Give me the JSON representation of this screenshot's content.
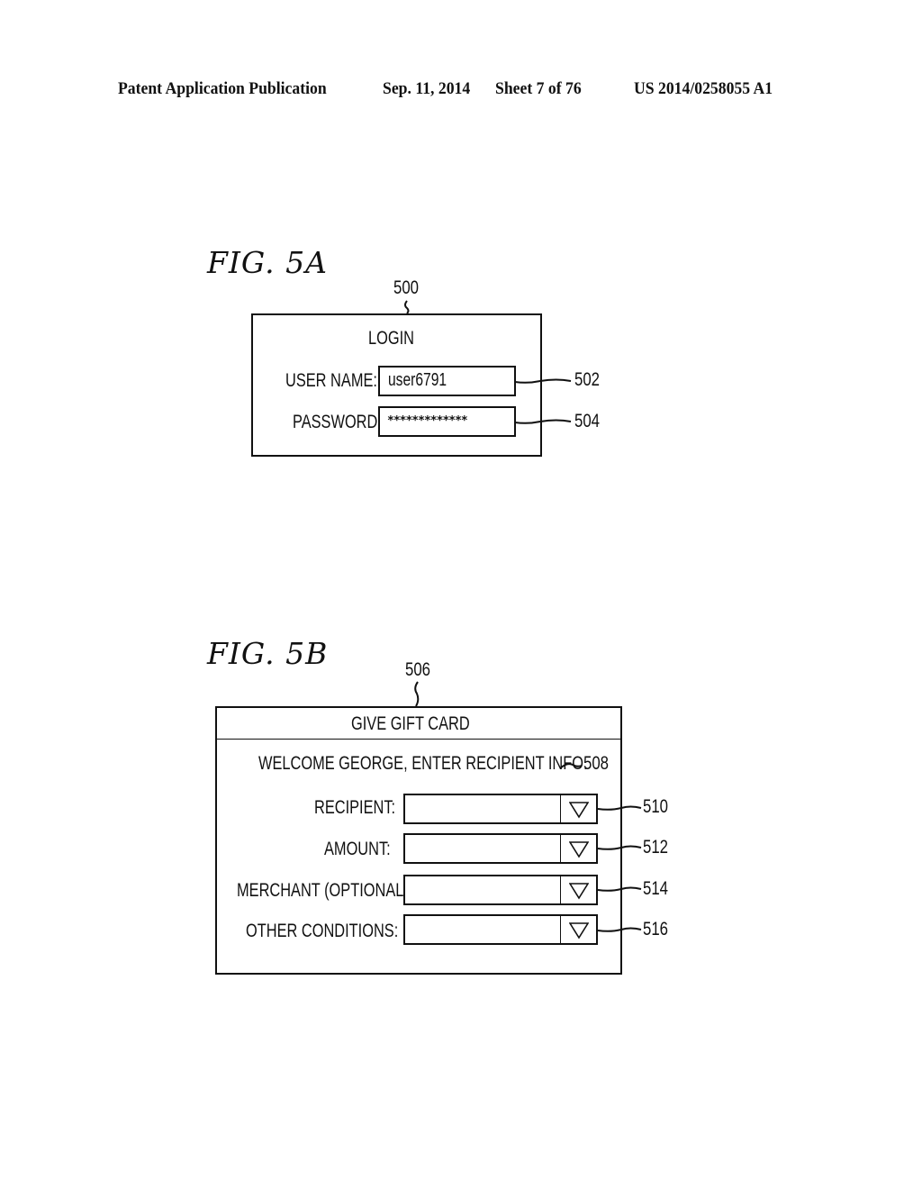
{
  "header": {
    "publication": "Patent Application Publication",
    "date": "Sep. 11, 2014",
    "sheet": "Sheet 7 of 76",
    "number": "US 2014/0258055 A1"
  },
  "fig5a": {
    "label": "FIG. 5A",
    "ref_screen": "500",
    "title": "LOGIN",
    "fields": [
      {
        "label": "USER NAME:",
        "value": "user6791",
        "ref": "502",
        "type": "text"
      },
      {
        "label": "PASSWORD:",
        "value": "*************",
        "ref": "504",
        "type": "password"
      }
    ]
  },
  "fig5b": {
    "label": "FIG. 5B",
    "ref_screen": "506",
    "title": "GIVE GIFT CARD",
    "welcome": "WELCOME GEORGE, ENTER RECIPIENT INFO.",
    "welcome_ref": "508",
    "dropdowns": [
      {
        "label": "RECIPIENT:",
        "value": "",
        "ref": "510",
        "icon": "triangle-down-icon"
      },
      {
        "label": "AMOUNT:",
        "value": "",
        "ref": "512",
        "icon": "triangle-down-icon"
      },
      {
        "label": "MERCHANT (OPTIONAL):",
        "value": "",
        "ref": "514",
        "icon": "triangle-down-icon"
      },
      {
        "label": "OTHER CONDITIONS:",
        "value": "",
        "ref": "516",
        "icon": "triangle-down-icon"
      }
    ]
  }
}
